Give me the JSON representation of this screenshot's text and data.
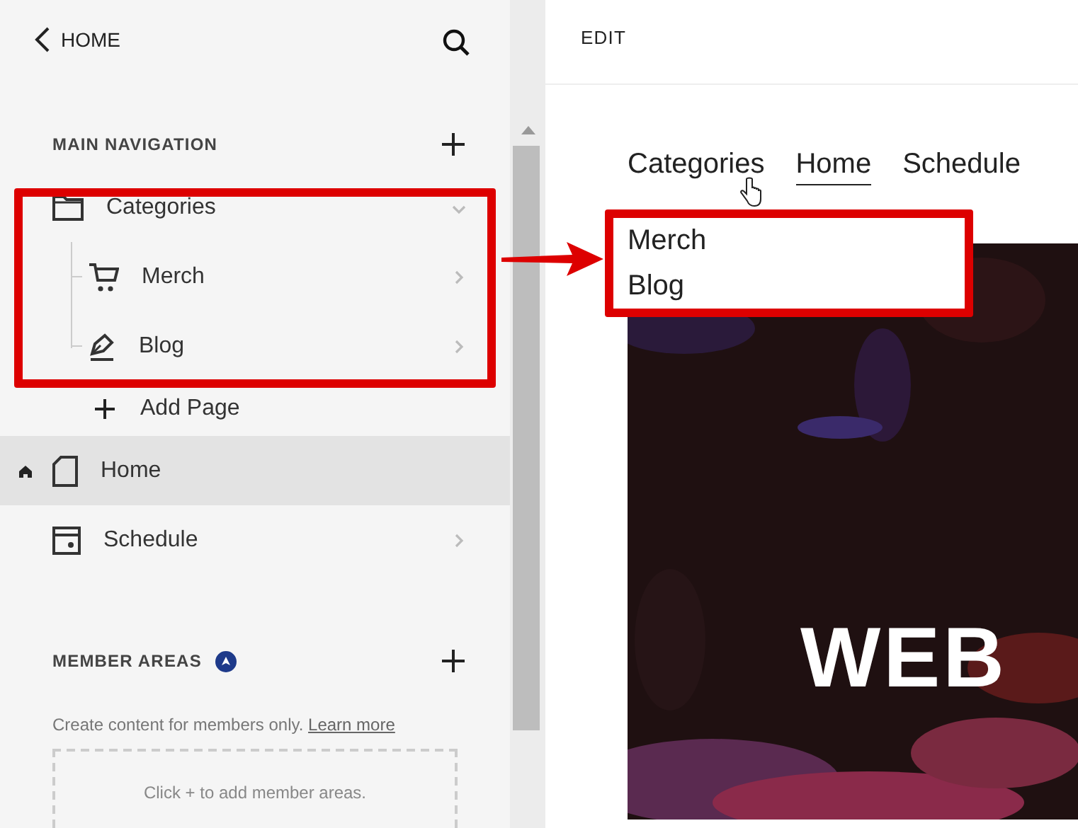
{
  "sidebar": {
    "back": {
      "label": "HOME"
    },
    "main_navigation": {
      "title": "MAIN NAVIGATION",
      "items": [
        {
          "label": "Categories",
          "kind": "folder",
          "expanded": true,
          "selected": false,
          "homepage": false,
          "children": [
            {
              "label": "Merch",
              "kind": "store",
              "selected": false
            },
            {
              "label": "Blog",
              "kind": "blog",
              "selected": false
            }
          ]
        },
        {
          "label": "Home",
          "kind": "page",
          "expanded": false,
          "selected": true,
          "homepage": true
        },
        {
          "label": "Schedule",
          "kind": "schedule",
          "expanded": false,
          "selected": false,
          "homepage": false
        }
      ],
      "add_page": "Add Page"
    },
    "member_areas": {
      "title": "MEMBER AREAS",
      "description": "Create content for members only.",
      "link": "Learn more",
      "empty": "Click + to add member areas."
    }
  },
  "preview": {
    "edit": "EDIT",
    "nav": [
      {
        "label": "Categories",
        "selected": false
      },
      {
        "label": "Home",
        "selected": true
      },
      {
        "label": "Schedule",
        "selected": false
      }
    ],
    "dropdown": [
      "Merch",
      "Blog"
    ],
    "hero": {
      "kind": "picture",
      "heading": "WEB"
    }
  }
}
